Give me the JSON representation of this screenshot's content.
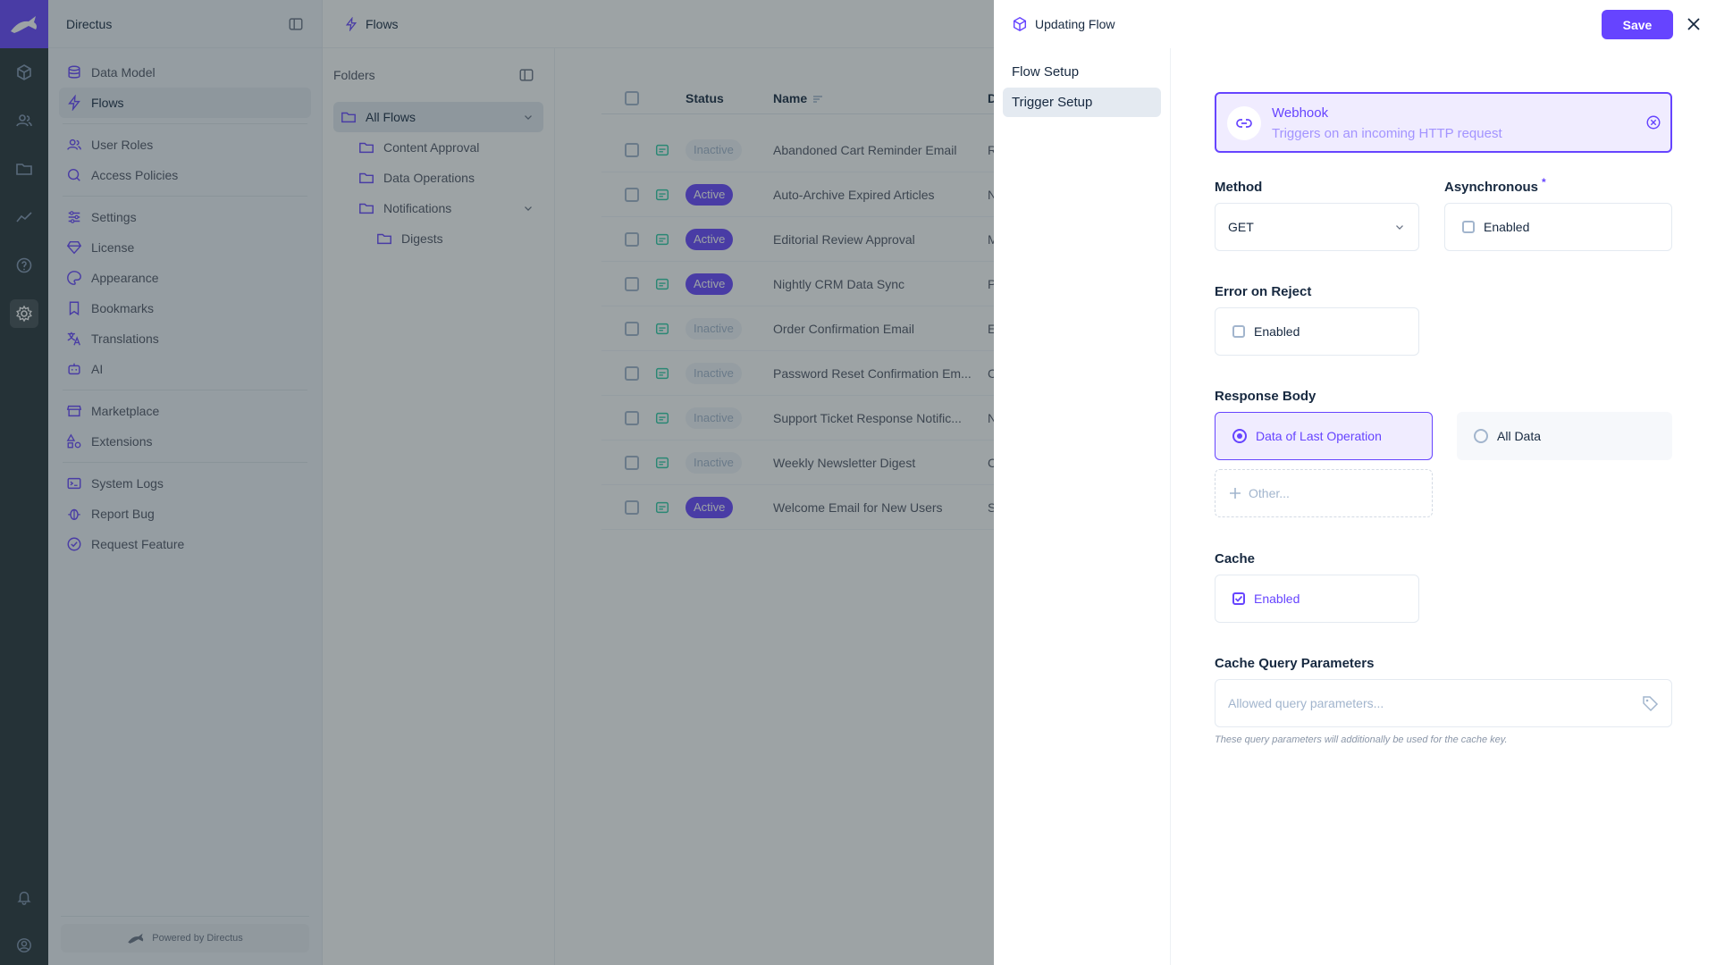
{
  "app": {
    "name": "Directus",
    "powered_by": "Powered by Directus"
  },
  "rail": {
    "icons": [
      "box-icon",
      "users-icon",
      "folder-icon",
      "insights-icon",
      "help-icon",
      "settings-icon",
      "bell-icon",
      "user-circle-icon"
    ]
  },
  "nav": {
    "items": [
      {
        "label": "Data Model",
        "icon": "database-icon"
      },
      {
        "label": "Flows",
        "icon": "bolt-icon"
      },
      {
        "label": "User Roles",
        "icon": "users-icon"
      },
      {
        "label": "Access Policies",
        "icon": "policy-icon"
      },
      {
        "label": "Settings",
        "icon": "sliders-icon"
      },
      {
        "label": "License",
        "icon": "diamond-icon"
      },
      {
        "label": "Appearance",
        "icon": "palette-icon"
      },
      {
        "label": "Bookmarks",
        "icon": "bookmark-icon"
      },
      {
        "label": "Translations",
        "icon": "translate-icon"
      },
      {
        "label": "AI",
        "icon": "robot-icon"
      },
      {
        "label": "Marketplace",
        "icon": "store-icon"
      },
      {
        "label": "Extensions",
        "icon": "shapes-icon"
      },
      {
        "label": "System Logs",
        "icon": "terminal-icon"
      },
      {
        "label": "Report Bug",
        "icon": "bug-icon"
      },
      {
        "label": "Request Feature",
        "icon": "check-badge-icon"
      }
    ]
  },
  "main": {
    "title": "Flows",
    "folders": {
      "heading": "Folders",
      "items": [
        {
          "label": "All Flows"
        },
        {
          "label": "Content Approval"
        },
        {
          "label": "Data Operations"
        },
        {
          "label": "Notifications"
        },
        {
          "label": "Digests"
        }
      ]
    },
    "table": {
      "headers": {
        "status": "Status",
        "name": "Name",
        "description": "De"
      },
      "rows": [
        {
          "status": "Inactive",
          "name": "Abandoned Cart Reminder Email",
          "desc": "Re"
        },
        {
          "status": "Active",
          "name": "Auto-Archive Expired Articles",
          "desc": "Nig"
        },
        {
          "status": "Active",
          "name": "Editorial Review Approval",
          "desc": "Mo"
        },
        {
          "status": "Active",
          "name": "Nightly CRM Data Sync",
          "desc": "Pu"
        },
        {
          "status": "Inactive",
          "name": "Order Confirmation Email",
          "desc": "Em"
        },
        {
          "status": "Inactive",
          "name": "Password Reset Confirmation Em...",
          "desc": "Co"
        },
        {
          "status": "Inactive",
          "name": "Support Ticket Response Notific...",
          "desc": "No"
        },
        {
          "status": "Inactive",
          "name": "Weekly Newsletter Digest",
          "desc": "Co"
        },
        {
          "status": "Active",
          "name": "Welcome Email for New Users",
          "desc": "Se"
        }
      ]
    }
  },
  "drawer": {
    "title": "Updating Flow",
    "save_label": "Save",
    "tabs": [
      {
        "label": "Flow Setup"
      },
      {
        "label": "Trigger Setup"
      }
    ],
    "trigger": {
      "title": "Webhook",
      "description": "Triggers on an incoming HTTP request"
    },
    "method": {
      "label": "Method",
      "value": "GET"
    },
    "asynchronous": {
      "label": "Asynchronous",
      "required": "*",
      "option": "Enabled"
    },
    "error_on_reject": {
      "label": "Error on Reject",
      "option": "Enabled"
    },
    "response_body": {
      "label": "Response Body",
      "options": [
        "Data of Last Operation",
        "All Data"
      ],
      "other": "Other..."
    },
    "cache": {
      "label": "Cache",
      "option": "Enabled"
    },
    "cache_query": {
      "label": "Cache Query Parameters",
      "placeholder": "Allowed query parameters...",
      "hint": "These query parameters will additionally be used for the cache key."
    }
  },
  "colors": {
    "accent": "#6644ff",
    "rail": "#263238",
    "nav_bg": "#f0f4f9"
  }
}
